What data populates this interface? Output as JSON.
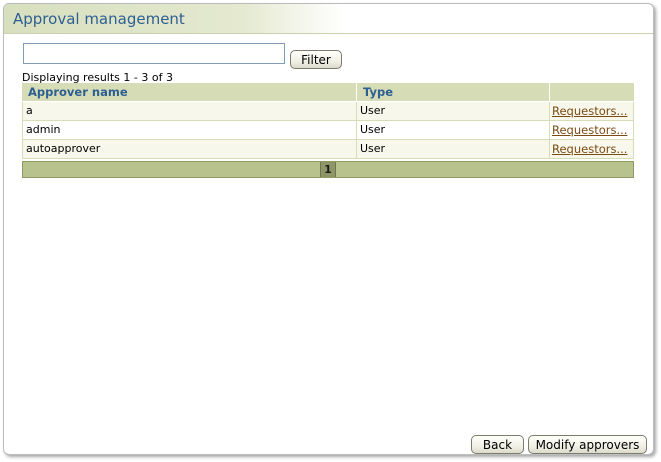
{
  "header": {
    "title": "Approval management"
  },
  "filter": {
    "value": "",
    "placeholder": "",
    "button_label": "Filter"
  },
  "results": {
    "summary": "Displaying results 1 - 3 of 3"
  },
  "table": {
    "columns": [
      "Approver name",
      "Type",
      ""
    ],
    "rows": [
      {
        "name": "a",
        "type": "User",
        "action": "Requestors..."
      },
      {
        "name": "admin",
        "type": "User",
        "action": "Requestors..."
      },
      {
        "name": "autoapprover",
        "type": "User",
        "action": "Requestors..."
      }
    ]
  },
  "pagination": {
    "current_page": "1"
  },
  "footer": {
    "back_label": "Back",
    "modify_label": "Modify approvers"
  },
  "colors": {
    "title_text": "#2d5f93",
    "header_bg": "#d6dcb6",
    "pager_bg": "#b8c28c",
    "link": "#7a4b12"
  }
}
